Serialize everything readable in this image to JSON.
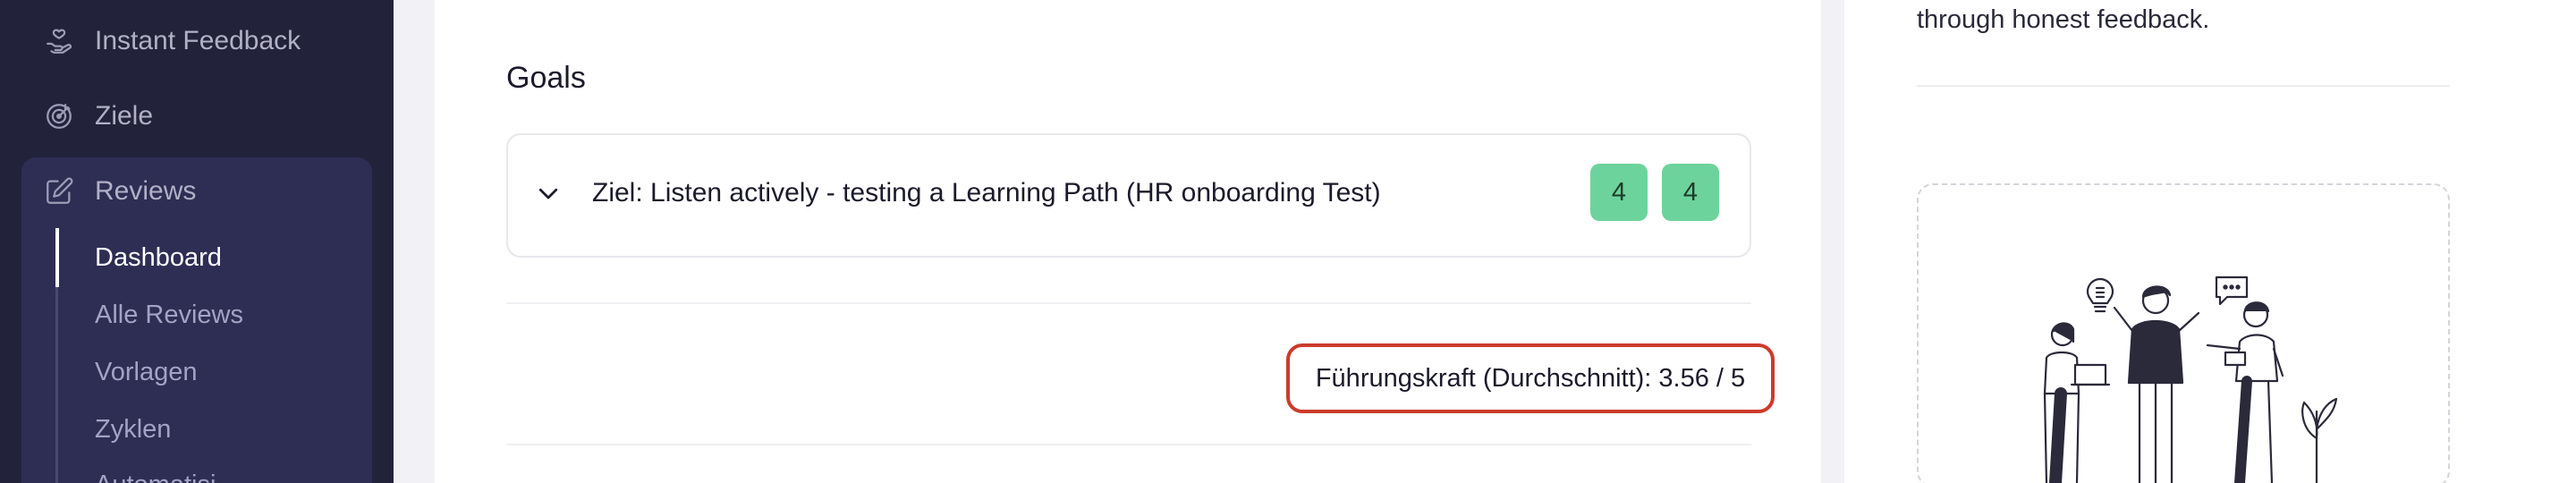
{
  "sidebar": {
    "items": [
      {
        "label": "Instant Feedback",
        "icon": "hand-heart-icon"
      },
      {
        "label": "Ziele",
        "icon": "target-icon"
      },
      {
        "label": "Reviews",
        "icon": "edit-icon"
      }
    ],
    "subitems": [
      {
        "label": "Dashboard",
        "active": true
      },
      {
        "label": "Alle Reviews"
      },
      {
        "label": "Vorlagen"
      },
      {
        "label": "Zyklen"
      },
      {
        "label": "Automatisi..."
      }
    ]
  },
  "main": {
    "goals_title": "Goals",
    "goal": {
      "text": "Ziel: Listen actively - testing a Learning Path (HR onboarding Test)",
      "scores": [
        "4",
        "4"
      ]
    },
    "average": "Führungskraft (Durchschnitt): 3.56 / 5"
  },
  "right": {
    "text": "through honest feedback."
  },
  "colors": {
    "sidebar_bg": "#23223b",
    "active_group_bg": "#2e2d54",
    "score_badge": "#6dd39c",
    "highlight_border": "#cc3b2b"
  }
}
